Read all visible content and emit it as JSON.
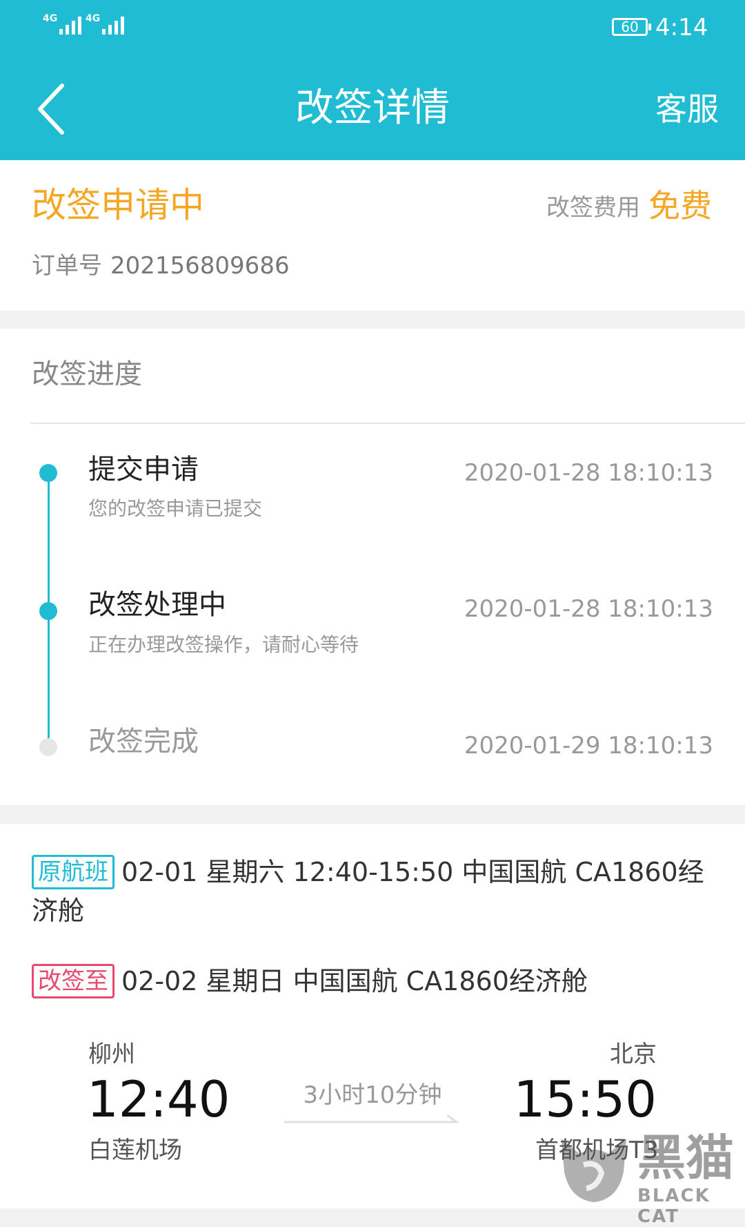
{
  "status_bar": {
    "network_1": "4G",
    "network_2": "4G",
    "battery": "60",
    "time": "4:14"
  },
  "header": {
    "title": "改签详情",
    "right_action": "客服",
    "back_icon": "chevron-left-icon"
  },
  "summary": {
    "status": "改签申请中",
    "fee_label": "改签费用",
    "fee_value": "免费",
    "order_label": "订单号",
    "order_number": "202156809686"
  },
  "progress": {
    "title": "改签进度",
    "steps": [
      {
        "title": "提交申请",
        "time": "2020-01-28 18:10:13",
        "desc": "您的改签申请已提交",
        "done": true
      },
      {
        "title": "改签处理中",
        "time": "2020-01-28 18:10:13",
        "desc": "正在办理改签操作，请耐心等待",
        "done": true
      },
      {
        "title": "改签完成",
        "time": "2020-01-29 18:10:13",
        "desc": "",
        "done": false
      }
    ]
  },
  "flights": {
    "original": {
      "tag": "原航班",
      "info": "02-01 星期六 12:40-15:50 中国国航 CA1860经济舱"
    },
    "changed": {
      "tag": "改签至",
      "info": "02-02 星期日 中国国航 CA1860经济舱"
    },
    "departure": {
      "city": "柳州",
      "time": "12:40",
      "airport": "白莲机场"
    },
    "arrival": {
      "city": "北京",
      "time": "15:50",
      "airport": "首都机场T3"
    },
    "duration": "3小时10分钟"
  },
  "watermark": {
    "cn": "黑猫",
    "en": "BLACK CAT"
  },
  "colors": {
    "primary": "#20bcd4",
    "accent_orange": "#f5a623",
    "tag_red": "#e84a6f",
    "background": "#f2f2f2"
  }
}
